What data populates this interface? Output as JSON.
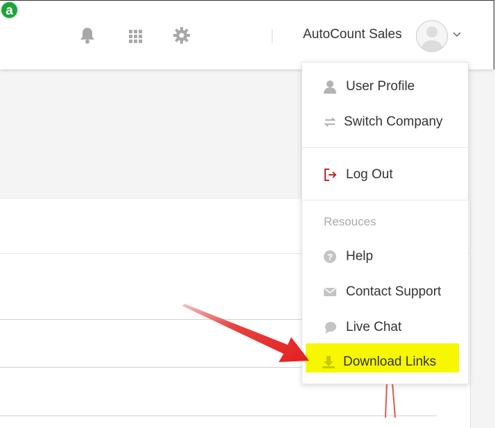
{
  "header": {
    "brand_letter": "a",
    "company": "AutoCount Sales"
  },
  "menu": {
    "items": [
      {
        "label": "User Profile",
        "icon": "user-icon"
      },
      {
        "label": "Switch Company",
        "icon": "switch-icon"
      },
      {
        "label": "Log Out",
        "icon": "logout-icon"
      }
    ],
    "section_label": "Resouces",
    "resources": [
      {
        "label": "Help",
        "icon": "help-icon"
      },
      {
        "label": "Contact Support",
        "icon": "envelope-icon"
      },
      {
        "label": "Live Chat",
        "icon": "chat-icon"
      },
      {
        "label": "Download Links",
        "icon": "download-icon"
      }
    ]
  },
  "colors": {
    "accent": "#1ea33b",
    "highlight": "#f7f700",
    "logout": "#c0282d",
    "arrow": "#e41f1f"
  }
}
